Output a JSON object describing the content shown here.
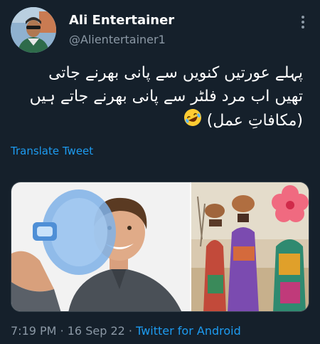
{
  "author": {
    "display_name": "Ali Entertainer",
    "handle": "@Alientertainer1",
    "avatar_icon": "profile-photo"
  },
  "tweet": {
    "lines": [
      "پہلے عورتیں کنویں سے پانی بھرنے جاتی",
      "تھیں اب مرد فلٹر سے پانی بھرنے جاتے ہیں",
      "(مکافاتِ عمل)"
    ],
    "emoji_icon": "rolling-on-the-floor-laughing"
  },
  "translate_label": "Translate Tweet",
  "meta": {
    "time": "7:19 PM",
    "separator": "·",
    "date": "16 Sep 22",
    "source": "Twitter for Android"
  },
  "more_icon": "more-options-icon",
  "colors": {
    "background": "#15202b",
    "text": "#ffffff",
    "secondary": "#8b98a5",
    "link": "#1d9bf0"
  }
}
